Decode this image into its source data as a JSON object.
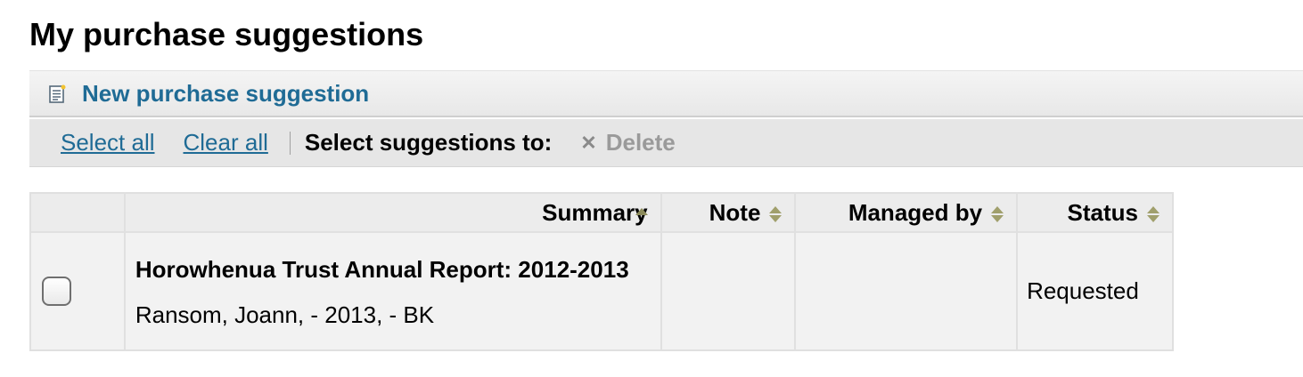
{
  "page": {
    "title": "My purchase suggestions"
  },
  "toolbar": {
    "new_label": "New purchase suggestion",
    "new_icon": "new-document-icon"
  },
  "selection": {
    "select_all": "Select all",
    "clear_all": "Clear all",
    "label": "Select suggestions to:",
    "delete_label": "Delete",
    "delete_icon": "close-icon"
  },
  "table": {
    "headers": {
      "summary": "Summary",
      "note": "Note",
      "managed_by": "Managed by",
      "status": "Status"
    },
    "sort": {
      "column": "summary",
      "direction": "ascending"
    },
    "rows": [
      {
        "checked": false,
        "title": "Horowhenua Trust Annual Report: 2012-2013",
        "meta": "Ransom, Joann, - 2013, - BK",
        "note": "",
        "managed_by": "",
        "status": "Requested"
      }
    ]
  },
  "colors": {
    "link": "#1f6b95",
    "disabled": "#9a9a9a",
    "sort_arrow": "#8b8a5a"
  }
}
